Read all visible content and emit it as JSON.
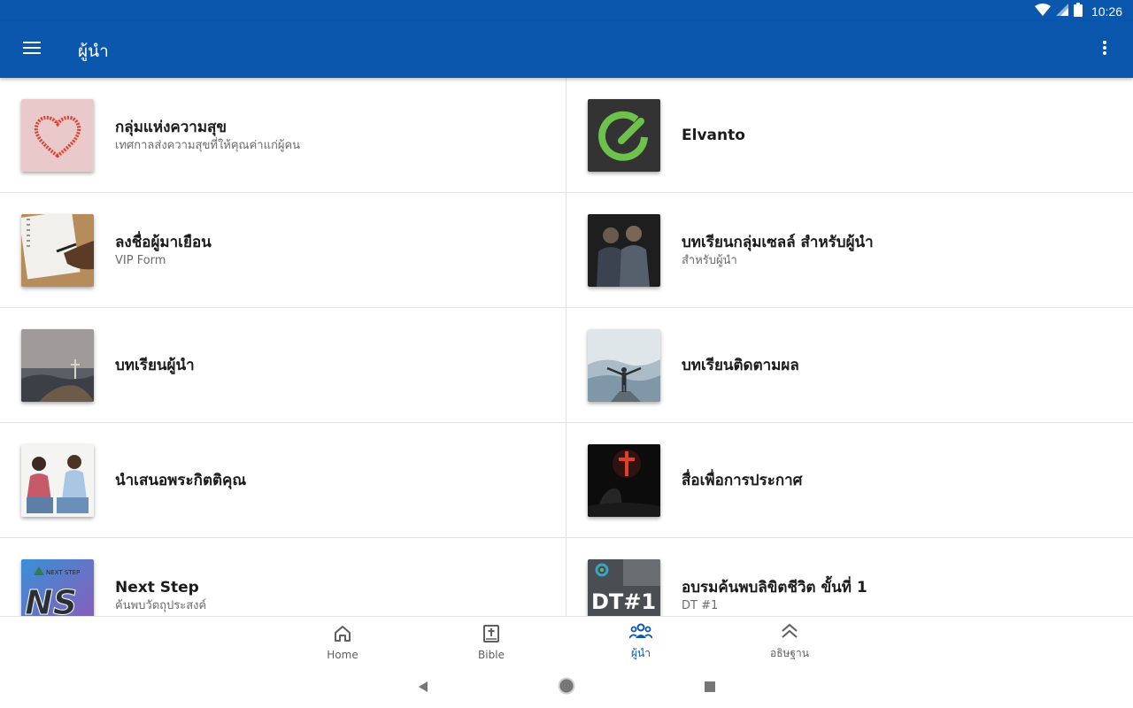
{
  "status_bar": {
    "time": "10:26"
  },
  "app_bar": {
    "title": "ผู้นำ",
    "menu_icon": "hamburger-menu-icon",
    "more_icon": "more-vertical-icon"
  },
  "items": [
    {
      "title": "กลุ่มแห่งความสุข",
      "subtitle": "เทศกาลส่งความสุขที่ให้คุณค่าแก่ผู้คน",
      "image": "heart-thumbnail"
    },
    {
      "title": "Elvanto",
      "subtitle": "",
      "image": "elvanto-logo"
    },
    {
      "title": "ลงชื่อผู้มาเยือน",
      "subtitle": "VIP Form",
      "image": "notebook-writing-thumbnail"
    },
    {
      "title": "บทเรียนกลุ่มเซลล์ สำหรับผู้นำ",
      "subtitle": "สำหรับผู้นำ",
      "image": "men-praying-thumbnail"
    },
    {
      "title": "บทเรียนผู้นำ",
      "subtitle": "",
      "image": "cross-on-hill-thumbnail"
    },
    {
      "title": "บทเรียนติดตามผล",
      "subtitle": "",
      "image": "man-on-mountain-thumbnail"
    },
    {
      "title": "นำเสนอพระกิตติคุณ",
      "subtitle": "",
      "image": "two-women-talking-thumbnail"
    },
    {
      "title": "สื่อเพื่อการประกาศ",
      "subtitle": "",
      "image": "lit-cross-thumbnail"
    },
    {
      "title": "Next Step",
      "subtitle": "ค้นพบวัตถุประสงค์",
      "image": "next-step-logo",
      "logo_text": "NS",
      "logo_small": "NEXT STEP"
    },
    {
      "title": "อบรมค้นพบลิขิตชีวิต ขั้นที่ 1",
      "subtitle": "DT #1",
      "image": "dt1-logo",
      "logo_text": "DT#1"
    }
  ],
  "bottom_nav": [
    {
      "label": "Home",
      "icon": "home-icon",
      "active": false
    },
    {
      "label": "Bible",
      "icon": "bible-icon",
      "active": false
    },
    {
      "label": "ผู้นำ",
      "icon": "people-group-icon",
      "active": true
    },
    {
      "label": "อธิษฐาน",
      "icon": "double-chevron-up-icon",
      "active": false
    }
  ],
  "colors": {
    "primary": "#0a57ad",
    "active_nav": "#0a57ad",
    "elvanto_green": "#6cc24a"
  }
}
